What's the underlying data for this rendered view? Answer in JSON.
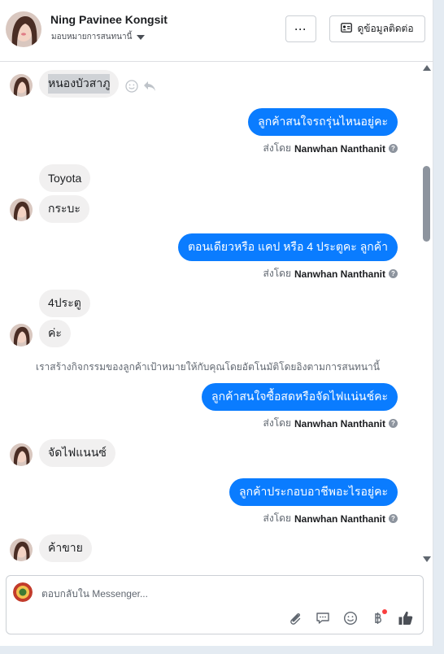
{
  "header": {
    "contact_name": "Ning Pavinee Kongsit",
    "assign_label": "มอบหมายการสนทนานี้",
    "more_label": "···",
    "contact_info_label": "ดูข้อมูลติดต่อ"
  },
  "messages": {
    "in_1": "หนองบัวสาภู",
    "out_1": "ลูกค้าสนใจรถรุ่นไหนอยู่คะ",
    "sent_by_prefix": "ส่งโดย",
    "agent_name": "Nanwhan Nanthanit",
    "in_2": "Toyota",
    "in_3": "กระบะ",
    "out_2": "ตอนเดียวหรือ แคป หรือ 4 ประตูคะ ลูกค้า",
    "in_4": "4ประตู",
    "in_5": "ค่ะ",
    "system_note": "เราสร้างกิจกรรมของลูกค้าเป้าหมายให้กับคุณโดยอัตโนมัติโดยอิงตามการสนทนานี้",
    "out_3": "ลูกค้าสนใจซื้อสดหรือจัดไฟแน่นช์คะ",
    "in_6": "จัดไฟแนนซ์",
    "out_4": "ลูกค้าประกอบอาชีพอะไรอยู่คะ",
    "in_7": "ค้าขาย"
  },
  "composer": {
    "placeholder": "ตอบกลับใน Messenger..."
  },
  "colors": {
    "outgoing_bubble": "#0a7cff",
    "incoming_bubble": "#f1f0f0",
    "notification_dot": "#fa3e3e"
  },
  "icons": [
    "more-icon",
    "contact-card-icon",
    "smile-icon",
    "reply-icon",
    "help-icon",
    "attach-icon",
    "saved-reply-icon",
    "emoji-icon",
    "baht-icon",
    "thumbs-up-icon"
  ]
}
